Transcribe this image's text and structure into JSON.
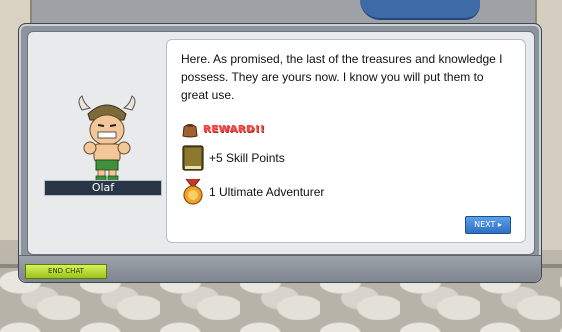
{
  "npc": {
    "name": "Olaf",
    "sprite": "viking-npc-sprite"
  },
  "dialog": {
    "message": "Here. As promised, the last of the treasures and knowledge I possess. They are yours now. I know you will put them to great use.",
    "reward_label": "REWARD!!",
    "rewards": [
      {
        "icon": "skill-book-icon",
        "text": "+5 Skill Points"
      },
      {
        "icon": "medal-icon",
        "text": "1 Ultimate Adventurer"
      }
    ],
    "next_label": "NEXT",
    "end_chat_label": "END CHAT"
  },
  "colors": {
    "reward_label": "#ff3c3c",
    "name_plate": "#2a3647",
    "next_button": "#3a80d6",
    "end_chat_button": "#b7d43a"
  }
}
